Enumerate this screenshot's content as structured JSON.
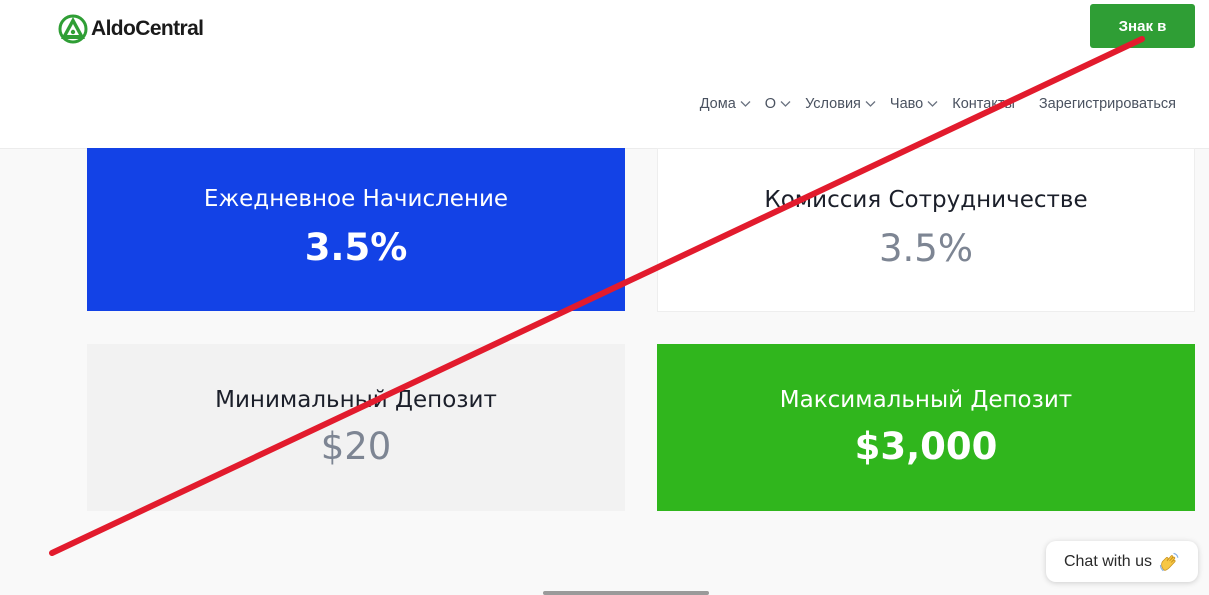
{
  "header": {
    "logo_text": "AldoCentral",
    "login_label": "Знак в",
    "nav": [
      {
        "label": "Дома",
        "has_dropdown": true
      },
      {
        "label": "О",
        "has_dropdown": true
      },
      {
        "label": "Условия",
        "has_dropdown": true
      },
      {
        "label": "Чаво",
        "has_dropdown": true
      },
      {
        "label": "Контакты",
        "has_dropdown": false
      },
      {
        "label": "Зарегистрироваться",
        "has_dropdown": false
      }
    ]
  },
  "cards": [
    {
      "title": "Ежедневное Начисление",
      "value": "3.5%"
    },
    {
      "title": "Комиссия Сотрудничестве",
      "value": "3.5%"
    },
    {
      "title": "Минимальный Депозит",
      "value": "$20"
    },
    {
      "title": "Максимальный Депозит",
      "value": "$3,000"
    }
  ],
  "chat": {
    "label": "Chat with us",
    "icon": "waving-hand-icon"
  },
  "colors": {
    "brand_green": "#2f9e35",
    "card_blue": "#1342e6",
    "card_green": "#30b61d",
    "overlay_red": "#e21b2d"
  }
}
